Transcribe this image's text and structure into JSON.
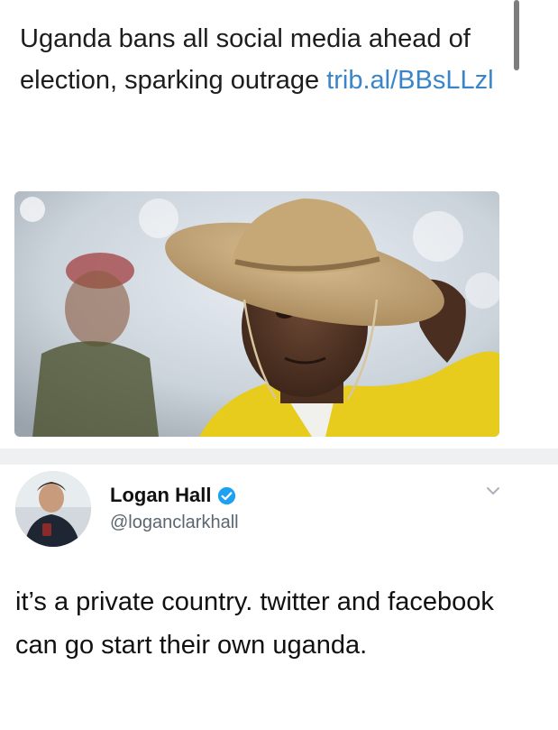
{
  "tweet": {
    "text": "Uganda bans all social media ahead of election, sparking outrage",
    "link": "trib.al/BBsLLzl"
  },
  "reply": {
    "display_name": "Logan Hall",
    "handle": "@loganclarkhall",
    "text": "it’s a private country. twitter and facebook can go start their own uganda.",
    "verified": true
  },
  "icons": {
    "verified": "verified-badge-icon",
    "menu": "chevron-down-icon"
  },
  "colors": {
    "link": "#3a85c9",
    "verified": "#1da1f2",
    "handle": "#5b6670"
  }
}
